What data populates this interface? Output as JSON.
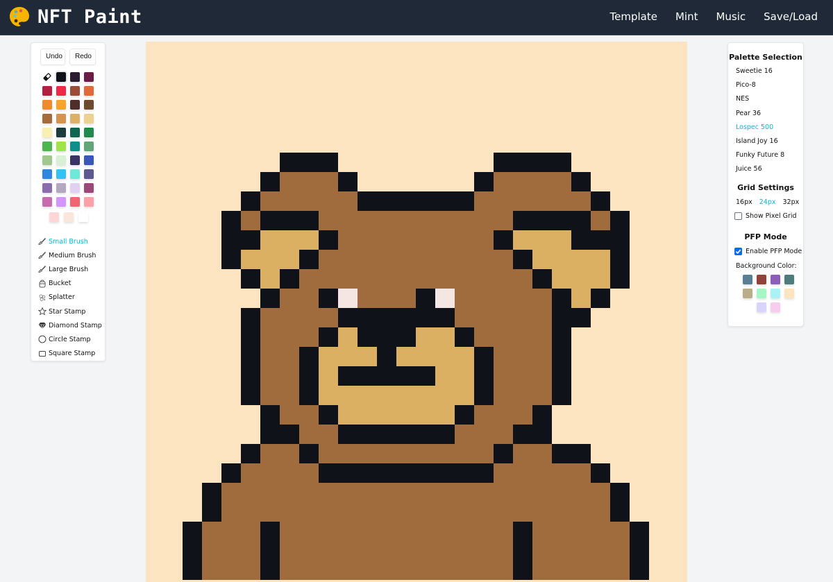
{
  "app": {
    "title": "NFT Paint",
    "logo_icon": "palette-icon"
  },
  "nav": {
    "links": [
      "Template",
      "Mint",
      "Music",
      "Save/Load"
    ]
  },
  "toolbar": {
    "undo_label": "Undo",
    "redo_label": "Redo",
    "eraser_icon": "eraser-icon",
    "selected_color": "#0f1119",
    "swatches": [
      "#0f1119",
      "#2b1d31",
      "#6b1d45",
      "#b21f3f",
      "#ee2a48",
      "#9b4d3a",
      "#e26a3a",
      "#f08a30",
      "#f5a52c",
      "#4e2e2a",
      "#6f4a2c",
      "#a46c3c",
      "#d49450",
      "#dcb068",
      "#ecd290",
      "#f8f0b0",
      "#1c3c3e",
      "#0e6650",
      "#1f8a4c",
      "#4db44e",
      "#a0e548",
      "#0e8f8c",
      "#62a678",
      "#a0c88e",
      "#d8f0d4",
      "#3a3466",
      "#3a56b8",
      "#2e86e0",
      "#34c2f6",
      "#6ee8d8",
      "#5c5890",
      "#8a6eac",
      "#b4a8c0",
      "#e2d0f0",
      "#9a4878",
      "#c46cae",
      "#d496fc",
      "#f06474",
      "#fca0a8"
    ],
    "extra_swatches": [
      "#fdd6d6",
      "#fbe6dc",
      "#ffffff"
    ],
    "tools": [
      {
        "label": "Small Brush",
        "icon": "brush-icon",
        "active": true
      },
      {
        "label": "Medium Brush",
        "icon": "brush-icon",
        "active": false
      },
      {
        "label": "Large Brush",
        "icon": "brush-icon",
        "active": false
      },
      {
        "label": "Bucket",
        "icon": "bucket-icon",
        "active": false
      },
      {
        "label": "Splatter",
        "icon": "splatter-icon",
        "active": false
      },
      {
        "label": "Star Stamp",
        "icon": "star-icon",
        "active": false
      },
      {
        "label": "Diamond Stamp",
        "icon": "diamond-icon",
        "active": false
      },
      {
        "label": "Circle Stamp",
        "icon": "circle-icon",
        "active": false
      },
      {
        "label": "Square Stamp",
        "icon": "square-icon",
        "active": false
      }
    ]
  },
  "canvas": {
    "background": "#fde4c0",
    "colors": {
      "K": "#10121a",
      "B": "#a06c3e",
      "T": "#dbb062",
      "W": "#f4e6e2"
    },
    "pixels": [
      "............................",
      "............................",
      "............................",
      "............................",
      "............................",
      "............................",
      ".......KKK........KKKK......",
      "......KBBBK......KBBBBK.....",
      ".....KBBBBBKKKKKKBBBBBBK....",
      "....KBKKKBBBBBBBBBBKKKKBK...",
      "....KKTTTKBBBBBBBBKTTTKKK...",
      "....KTTTKBBBBBBBBBBKTTTTK...",
      ".....KTKBBBBBBBBBBBBKTTTK...",
      "......KBBKWBBBKWBBBBBKTK....",
      ".....KBBBBKKKKKKBBBBBKK.....",
      ".....KBBBKTKKKTTKBBBBK......",
      ".....KBBKTTTKTTTTKBBBK......",
      ".....KBBKTKKKKKTTKBBBK......",
      ".....KBBKTTTTTTTTKBBBK......",
      "......KBBKTTTTTTKBBBK.......",
      "......KKBBKKKKKKBBBKK.......",
      ".....KBBKBBBBBBBBBKBBKK.....",
      "....KBBBBKKKKKKKKKBBBBBK....",
      "...KBBBBBBBBBBBBBBBBBBBBK...",
      "...KBBBBBBBBBBBBBBBBBBBBK...",
      "..KBBBKBBBBBBBBBBBBKBBBBBK..",
      "..KBBBKBBBBBBBBBBBBKBBBBBK..",
      "..KBBBKBBBBBBBBBBBBKBBBBBK.."
    ]
  },
  "settings": {
    "palette_heading": "Palette Selection",
    "palettes": [
      {
        "label": "Sweetie 16",
        "active": false
      },
      {
        "label": "Pico-8",
        "active": false
      },
      {
        "label": "NES",
        "active": false
      },
      {
        "label": "Pear 36",
        "active": false
      },
      {
        "label": "Lospec 500",
        "active": true
      },
      {
        "label": "Island Joy 16",
        "active": false
      },
      {
        "label": "Funky Future 8",
        "active": false
      },
      {
        "label": "Juice 56",
        "active": false
      }
    ],
    "grid_heading": "Grid Settings",
    "grid_sizes": [
      {
        "label": "16px",
        "active": false
      },
      {
        "label": "24px",
        "active": true
      },
      {
        "label": "32px",
        "active": false
      }
    ],
    "show_grid_label": "Show Pixel Grid",
    "show_grid_checked": false,
    "pfp_heading": "PFP Mode",
    "pfp_enable_label": "Enable PFP Mode",
    "pfp_enabled": true,
    "bg_color_label": "Background Color:",
    "bg_colors": [
      "#5a7f92",
      "#8e433b",
      "#8c5eb8",
      "#4e7c7c",
      "#b9ad8a",
      "#a6f5c4",
      "#aaf2f5",
      "#fde4c0",
      "#d8d4fc",
      "#f6cdef"
    ]
  }
}
